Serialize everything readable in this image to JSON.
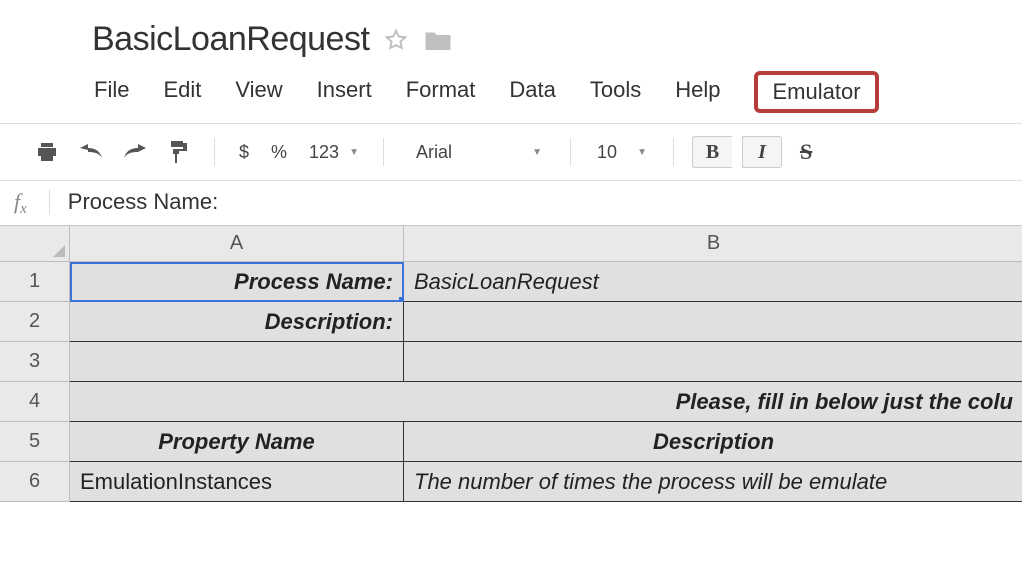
{
  "doc": {
    "title": "BasicLoanRequest"
  },
  "menu": {
    "file": "File",
    "edit": "Edit",
    "view": "View",
    "insert": "Insert",
    "format": "Format",
    "data": "Data",
    "tools": "Tools",
    "help": "Help",
    "emulator": "Emulator"
  },
  "toolbar": {
    "currency": "$",
    "percent": "%",
    "numfmt": "123",
    "font": "Arial",
    "size": "10",
    "bold": "B",
    "italic": "I",
    "strike": "S"
  },
  "formula": {
    "fx_f": "f",
    "fx_x": "x",
    "content": "Process Name:"
  },
  "columns": {
    "A": "A",
    "B": "B"
  },
  "rowlabels": {
    "1": "1",
    "2": "2",
    "3": "3",
    "4": "4",
    "5": "5",
    "6": "6"
  },
  "cells": {
    "A1": "Process Name:",
    "B1": "BasicLoanRequest",
    "A2": "Description:",
    "B2": "",
    "A3": "",
    "B3": "",
    "row4": "Please, fill in below just the colu",
    "A5": "Property Name",
    "B5": "Description",
    "A6": "EmulationInstances",
    "B6": "The number of times the process will be emulate"
  }
}
